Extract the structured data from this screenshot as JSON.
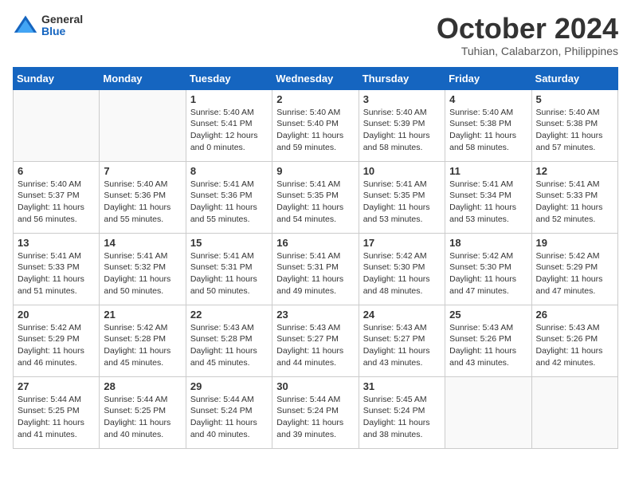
{
  "header": {
    "logo_general": "General",
    "logo_blue": "Blue",
    "month_title": "October 2024",
    "location": "Tuhian, Calabarzon, Philippines"
  },
  "weekdays": [
    "Sunday",
    "Monday",
    "Tuesday",
    "Wednesday",
    "Thursday",
    "Friday",
    "Saturday"
  ],
  "weeks": [
    [
      {
        "day": "",
        "empty": true
      },
      {
        "day": "",
        "empty": true
      },
      {
        "day": "1",
        "sunrise": "Sunrise: 5:40 AM",
        "sunset": "Sunset: 5:41 PM",
        "daylight": "Daylight: 12 hours and 0 minutes."
      },
      {
        "day": "2",
        "sunrise": "Sunrise: 5:40 AM",
        "sunset": "Sunset: 5:40 PM",
        "daylight": "Daylight: 11 hours and 59 minutes."
      },
      {
        "day": "3",
        "sunrise": "Sunrise: 5:40 AM",
        "sunset": "Sunset: 5:39 PM",
        "daylight": "Daylight: 11 hours and 58 minutes."
      },
      {
        "day": "4",
        "sunrise": "Sunrise: 5:40 AM",
        "sunset": "Sunset: 5:38 PM",
        "daylight": "Daylight: 11 hours and 58 minutes."
      },
      {
        "day": "5",
        "sunrise": "Sunrise: 5:40 AM",
        "sunset": "Sunset: 5:38 PM",
        "daylight": "Daylight: 11 hours and 57 minutes."
      }
    ],
    [
      {
        "day": "6",
        "sunrise": "Sunrise: 5:40 AM",
        "sunset": "Sunset: 5:37 PM",
        "daylight": "Daylight: 11 hours and 56 minutes."
      },
      {
        "day": "7",
        "sunrise": "Sunrise: 5:40 AM",
        "sunset": "Sunset: 5:36 PM",
        "daylight": "Daylight: 11 hours and 55 minutes."
      },
      {
        "day": "8",
        "sunrise": "Sunrise: 5:41 AM",
        "sunset": "Sunset: 5:36 PM",
        "daylight": "Daylight: 11 hours and 55 minutes."
      },
      {
        "day": "9",
        "sunrise": "Sunrise: 5:41 AM",
        "sunset": "Sunset: 5:35 PM",
        "daylight": "Daylight: 11 hours and 54 minutes."
      },
      {
        "day": "10",
        "sunrise": "Sunrise: 5:41 AM",
        "sunset": "Sunset: 5:35 PM",
        "daylight": "Daylight: 11 hours and 53 minutes."
      },
      {
        "day": "11",
        "sunrise": "Sunrise: 5:41 AM",
        "sunset": "Sunset: 5:34 PM",
        "daylight": "Daylight: 11 hours and 53 minutes."
      },
      {
        "day": "12",
        "sunrise": "Sunrise: 5:41 AM",
        "sunset": "Sunset: 5:33 PM",
        "daylight": "Daylight: 11 hours and 52 minutes."
      }
    ],
    [
      {
        "day": "13",
        "sunrise": "Sunrise: 5:41 AM",
        "sunset": "Sunset: 5:33 PM",
        "daylight": "Daylight: 11 hours and 51 minutes."
      },
      {
        "day": "14",
        "sunrise": "Sunrise: 5:41 AM",
        "sunset": "Sunset: 5:32 PM",
        "daylight": "Daylight: 11 hours and 50 minutes."
      },
      {
        "day": "15",
        "sunrise": "Sunrise: 5:41 AM",
        "sunset": "Sunset: 5:31 PM",
        "daylight": "Daylight: 11 hours and 50 minutes."
      },
      {
        "day": "16",
        "sunrise": "Sunrise: 5:41 AM",
        "sunset": "Sunset: 5:31 PM",
        "daylight": "Daylight: 11 hours and 49 minutes."
      },
      {
        "day": "17",
        "sunrise": "Sunrise: 5:42 AM",
        "sunset": "Sunset: 5:30 PM",
        "daylight": "Daylight: 11 hours and 48 minutes."
      },
      {
        "day": "18",
        "sunrise": "Sunrise: 5:42 AM",
        "sunset": "Sunset: 5:30 PM",
        "daylight": "Daylight: 11 hours and 47 minutes."
      },
      {
        "day": "19",
        "sunrise": "Sunrise: 5:42 AM",
        "sunset": "Sunset: 5:29 PM",
        "daylight": "Daylight: 11 hours and 47 minutes."
      }
    ],
    [
      {
        "day": "20",
        "sunrise": "Sunrise: 5:42 AM",
        "sunset": "Sunset: 5:29 PM",
        "daylight": "Daylight: 11 hours and 46 minutes."
      },
      {
        "day": "21",
        "sunrise": "Sunrise: 5:42 AM",
        "sunset": "Sunset: 5:28 PM",
        "daylight": "Daylight: 11 hours and 45 minutes."
      },
      {
        "day": "22",
        "sunrise": "Sunrise: 5:43 AM",
        "sunset": "Sunset: 5:28 PM",
        "daylight": "Daylight: 11 hours and 45 minutes."
      },
      {
        "day": "23",
        "sunrise": "Sunrise: 5:43 AM",
        "sunset": "Sunset: 5:27 PM",
        "daylight": "Daylight: 11 hours and 44 minutes."
      },
      {
        "day": "24",
        "sunrise": "Sunrise: 5:43 AM",
        "sunset": "Sunset: 5:27 PM",
        "daylight": "Daylight: 11 hours and 43 minutes."
      },
      {
        "day": "25",
        "sunrise": "Sunrise: 5:43 AM",
        "sunset": "Sunset: 5:26 PM",
        "daylight": "Daylight: 11 hours and 43 minutes."
      },
      {
        "day": "26",
        "sunrise": "Sunrise: 5:43 AM",
        "sunset": "Sunset: 5:26 PM",
        "daylight": "Daylight: 11 hours and 42 minutes."
      }
    ],
    [
      {
        "day": "27",
        "sunrise": "Sunrise: 5:44 AM",
        "sunset": "Sunset: 5:25 PM",
        "daylight": "Daylight: 11 hours and 41 minutes."
      },
      {
        "day": "28",
        "sunrise": "Sunrise: 5:44 AM",
        "sunset": "Sunset: 5:25 PM",
        "daylight": "Daylight: 11 hours and 40 minutes."
      },
      {
        "day": "29",
        "sunrise": "Sunrise: 5:44 AM",
        "sunset": "Sunset: 5:24 PM",
        "daylight": "Daylight: 11 hours and 40 minutes."
      },
      {
        "day": "30",
        "sunrise": "Sunrise: 5:44 AM",
        "sunset": "Sunset: 5:24 PM",
        "daylight": "Daylight: 11 hours and 39 minutes."
      },
      {
        "day": "31",
        "sunrise": "Sunrise: 5:45 AM",
        "sunset": "Sunset: 5:24 PM",
        "daylight": "Daylight: 11 hours and 38 minutes."
      },
      {
        "day": "",
        "empty": true
      },
      {
        "day": "",
        "empty": true
      }
    ]
  ]
}
